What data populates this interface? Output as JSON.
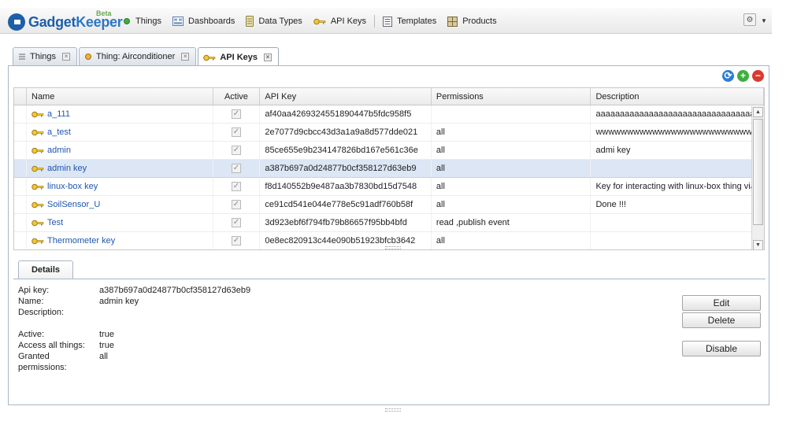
{
  "app": {
    "logo_gadget": "Gadget",
    "logo_keeper": "Keeper",
    "beta": "Beta"
  },
  "nav": {
    "things": "Things",
    "dashboards": "Dashboards",
    "data_types": "Data Types",
    "api_keys": "API Keys",
    "templates": "Templates",
    "products": "Products"
  },
  "tabs": [
    {
      "label": "Things"
    },
    {
      "label": "Thing: Airconditioner"
    },
    {
      "label": "API Keys"
    }
  ],
  "grid": {
    "columns": [
      "Name",
      "Active",
      "API Key",
      "Permissions",
      "Description"
    ],
    "rows": [
      {
        "name": "a_111",
        "active": true,
        "key": "af40aa4269324551890447b5fdc958f5",
        "permissions": "",
        "description": "aaaaaaaaaaaaaaaaaaaaaaaaaaaaaaaaaaaaa"
      },
      {
        "name": "a_test",
        "active": true,
        "key": "2e7077d9cbcc43d3a1a9a8d577dde021",
        "permissions": "all",
        "description": "wwwwwwwwwwwwwwwwwwwwwwwwwwww"
      },
      {
        "name": "admin",
        "active": true,
        "key": "85ce655e9b234147826bd167e561c36e",
        "permissions": "all",
        "description": "admi key"
      },
      {
        "name": "admin key",
        "active": true,
        "key": "a387b697a0d24877b0cf358127d63eb9",
        "permissions": "all",
        "description": ""
      },
      {
        "name": "linux-box key",
        "active": true,
        "key": "f8d140552b9e487aa3b7830bd15d7548",
        "permissions": "all",
        "description": "Key for interacting with linux-box thing via A"
      },
      {
        "name": "SoilSensor_U",
        "active": true,
        "key": "ce91cd541e044e778e5c91adf760b58f",
        "permissions": "all",
        "description": "Done !!!"
      },
      {
        "name": "Test",
        "active": true,
        "key": "3d923ebf6f794fb79b86657f95bb4bfd",
        "permissions": "read ,publish event",
        "description": ""
      },
      {
        "name": "Thermometer key",
        "active": true,
        "key": "0e8ec820913c44e090b51923bfcb3642",
        "permissions": "all",
        "description": ""
      }
    ],
    "selected_index": 3
  },
  "details": {
    "tab_label": "Details",
    "api_key_label": "Api key:",
    "api_key_value": "a387b697a0d24877b0cf358127d63eb9",
    "name_label": "Name:",
    "name_value": "admin key",
    "description_label": "Description:",
    "description_value": "",
    "active_label": "Active:",
    "active_value": "true",
    "access_label": "Access all things:",
    "access_value": "true",
    "granted_label": "Granted permissions:",
    "granted_value": "all"
  },
  "actions": {
    "edit": "Edit",
    "delete": "Delete",
    "disable": "Disable"
  },
  "colors": {
    "brand": "#1d5fa8",
    "link": "#1f56b0",
    "selected_row": "#dce6f4",
    "refresh": "#2f7bd4",
    "add": "#3fae3f",
    "remove": "#d93a2f"
  },
  "icons": {
    "things": "green-dot-icon",
    "dashboards": "dashboard-icon",
    "data_types": "database-icon",
    "api_keys": "key-icon",
    "templates": "template-icon",
    "products": "products-icon"
  }
}
